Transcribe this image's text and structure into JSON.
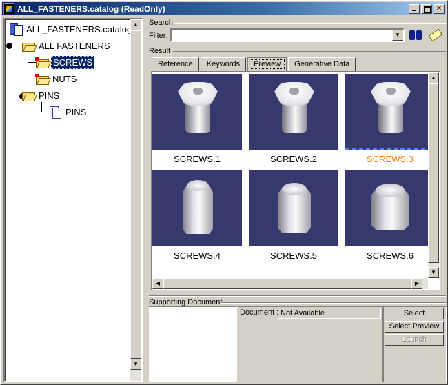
{
  "window": {
    "title": "ALL_FASTENERS.catalog (ReadOnly)",
    "minimize": "_",
    "maximize": "□",
    "close": "✕"
  },
  "tree": {
    "root": "ALL_FASTENERS.catalog",
    "items": [
      {
        "label": "ALL FASTENERS"
      },
      {
        "label": "SCREWS",
        "selected": true
      },
      {
        "label": "NUTS"
      },
      {
        "label": "PINS"
      },
      {
        "label": "PINS"
      }
    ]
  },
  "search": {
    "group_label": "Search",
    "filter_label": "Filter:",
    "filter_value": ""
  },
  "result": {
    "group_label": "Result",
    "tabs": [
      "Reference",
      "Keywords",
      "Preview",
      "Generative Data"
    ],
    "active_tab": "Preview",
    "items": [
      {
        "label": "SCREWS.1"
      },
      {
        "label": "SCREWS.2"
      },
      {
        "label": "SCREWS.3",
        "highlighted": true
      },
      {
        "label": "SCREWS.4"
      },
      {
        "label": "SCREWS.5"
      },
      {
        "label": "SCREWS.6"
      }
    ]
  },
  "supporting": {
    "group_label": "Supporting Document",
    "document_label": "Document :",
    "document_value": "Not Available",
    "buttons": {
      "select": "Select",
      "select_preview": "Select Preview",
      "launch": "Launch"
    }
  },
  "scroll": {
    "up": "▲",
    "down": "▼",
    "left": "◀",
    "right": "▶",
    "dropdown": "▼"
  },
  "colors": {
    "titlebar": "#0a246a",
    "thumb_bg": "#36386e",
    "highlight_text": "#f08010",
    "selection": "#0a246a"
  }
}
